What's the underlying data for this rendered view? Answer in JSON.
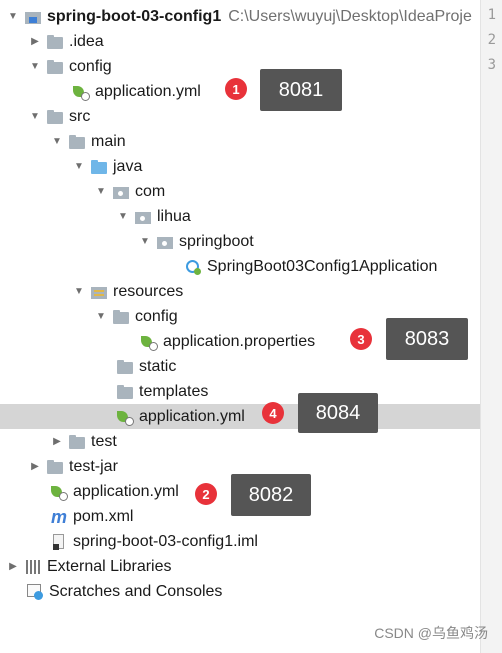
{
  "project": {
    "name": "spring-boot-03-config1",
    "path": "C:\\Users\\wuyuj\\Desktop\\IdeaProje"
  },
  "tree": [
    {
      "label": "spring-boot-03-config1",
      "icon": "module-folder-icon",
      "arrow": "down"
    },
    {
      "label": ".idea",
      "icon": "folder-icon",
      "arrow": "right"
    },
    {
      "label": "config",
      "icon": "folder-icon",
      "arrow": "down"
    },
    {
      "label": "application.yml",
      "icon": "spring-config-icon"
    },
    {
      "label": "src",
      "icon": "folder-icon",
      "arrow": "down"
    },
    {
      "label": "main",
      "icon": "folder-icon",
      "arrow": "down"
    },
    {
      "label": "java",
      "icon": "source-folder-icon",
      "arrow": "down"
    },
    {
      "label": "com",
      "icon": "package-icon",
      "arrow": "down"
    },
    {
      "label": "lihua",
      "icon": "package-icon",
      "arrow": "down"
    },
    {
      "label": "springboot",
      "icon": "package-icon",
      "arrow": "down"
    },
    {
      "label": "SpringBoot03Config1Application",
      "icon": "spring-app-class-icon"
    },
    {
      "label": "resources",
      "icon": "resources-folder-icon",
      "arrow": "down"
    },
    {
      "label": "config",
      "icon": "folder-icon",
      "arrow": "down"
    },
    {
      "label": "application.properties",
      "icon": "spring-config-icon"
    },
    {
      "label": "static",
      "icon": "folder-icon"
    },
    {
      "label": "templates",
      "icon": "folder-icon"
    },
    {
      "label": "application.yml",
      "icon": "spring-config-icon"
    },
    {
      "label": "test",
      "icon": "folder-icon",
      "arrow": "right"
    },
    {
      "label": "test-jar",
      "icon": "folder-icon",
      "arrow": "right"
    },
    {
      "label": "application.yml",
      "icon": "spring-config-icon"
    },
    {
      "label": "pom.xml",
      "icon": "maven-icon"
    },
    {
      "label": "spring-boot-03-config1.iml",
      "icon": "iml-file-icon"
    },
    {
      "label": "External Libraries",
      "icon": "libraries-icon",
      "arrow": "right"
    },
    {
      "label": "Scratches and Consoles",
      "icon": "scratches-icon"
    }
  ],
  "gutter": {
    "lines": [
      "1",
      "2",
      "3"
    ]
  },
  "annotations": [
    {
      "badge": "1",
      "value": "8081"
    },
    {
      "badge": "2",
      "value": "8082"
    },
    {
      "badge": "3",
      "value": "8083"
    },
    {
      "badge": "4",
      "value": "8084"
    }
  ],
  "watermark": "CSDN @乌鱼鸡汤",
  "colors": {
    "badge": "#e8323a",
    "callout": "#555555",
    "selection": "#d5d5d5"
  }
}
